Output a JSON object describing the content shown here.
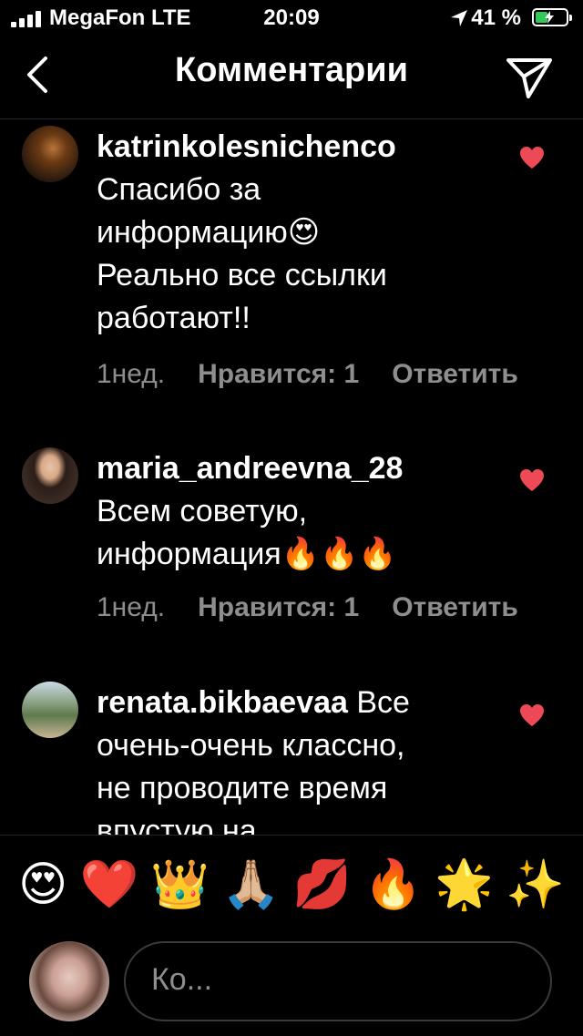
{
  "status_bar": {
    "carrier": "MegaFon LTE",
    "time": "20:09",
    "battery_percent": "41 %",
    "battery_level": 0.41,
    "icons": [
      "signal-icon",
      "location-arrow-icon",
      "battery-charging-icon"
    ]
  },
  "header": {
    "title": "Комментарии",
    "back_icon": "chevron-left-icon",
    "share_icon": "paper-plane-icon"
  },
  "comments": [
    {
      "username": "katrinkolesnichenco",
      "lines": [
        "Спасибо за",
        "информацию😍",
        "Реально все ссылки",
        "работают!!"
      ],
      "time_ago": "1нед.",
      "likes": "Нравится: 1",
      "reply": "Ответить"
    },
    {
      "username": "maria_andreevna_28",
      "lines": [
        "Всем советую,",
        "информация🔥🔥🔥"
      ],
      "time_ago": "1нед.",
      "likes": "Нравится: 1",
      "reply": "Ответить"
    },
    {
      "username": "renata.bikbaevaa",
      "lines": [
        " Все",
        "очень-очень классно,",
        "не проводите время",
        "впустую на"
      ]
    }
  ],
  "quick_emojis": [
    "😍",
    "❤️",
    "👑",
    "🙏🏼",
    "💋",
    "🔥",
    "🌟",
    "✨"
  ],
  "composer": {
    "placeholder": "Ко..."
  },
  "colors": {
    "background": "#000000",
    "muted_text": "#8e8e8e",
    "like_heart": "#ed4956",
    "battery_fill": "#34c759"
  }
}
